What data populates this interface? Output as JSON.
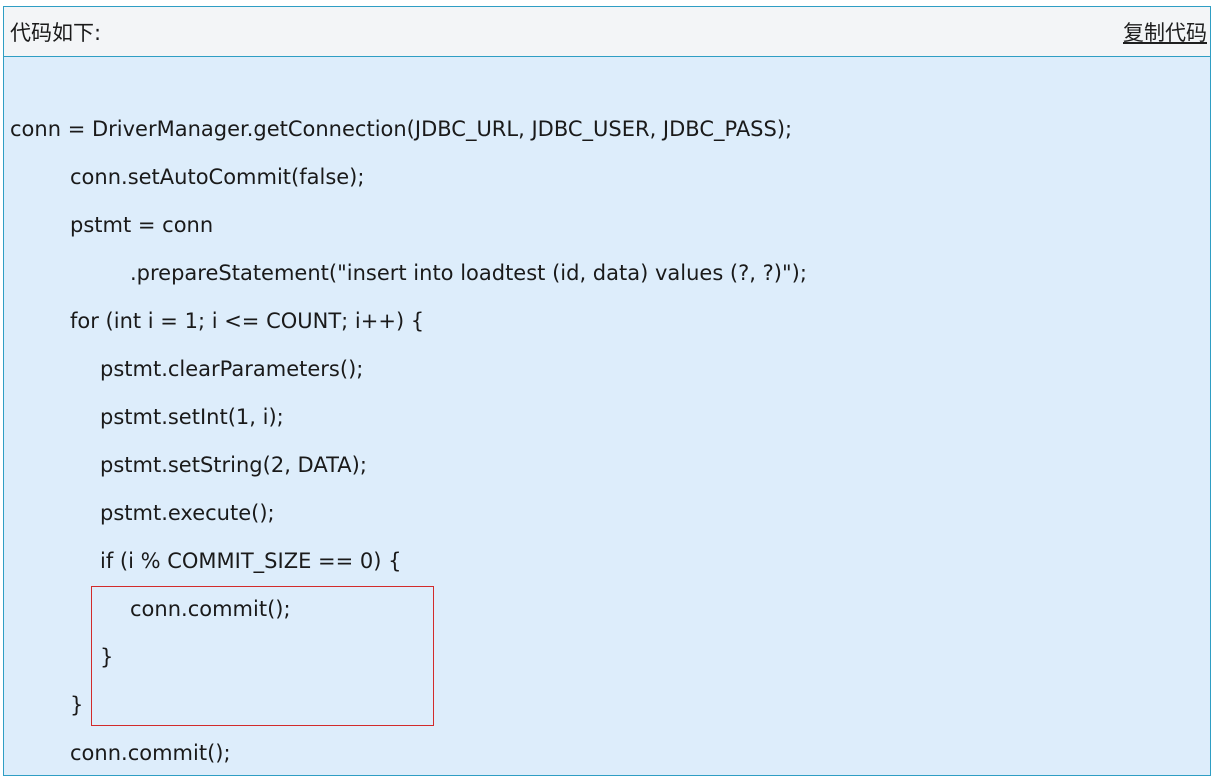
{
  "header": {
    "title": "代码如下:",
    "copy_label": "复制代码"
  },
  "code": {
    "lines": [
      "conn = DriverManager.getConnection(JDBC_URL, JDBC_USER, JDBC_PASS);",
      "conn.setAutoCommit(false);",
      "pstmt = conn",
      ".prepareStatement(\"insert into loadtest (id, data) values (?, ?)\");",
      "for (int i = 1; i <= COUNT; i++) {",
      "pstmt.clearParameters();",
      "pstmt.setInt(1, i);",
      "pstmt.setString(2, DATA);",
      "pstmt.execute();",
      "if (i % COMMIT_SIZE == 0) {",
      "conn.commit();",
      "}",
      "}",
      "conn.commit();"
    ]
  },
  "colors": {
    "border": "#2f9ec4",
    "background": "#ddedfb",
    "header_bg": "#f3f5f7",
    "highlight_border": "#d22b2b"
  }
}
